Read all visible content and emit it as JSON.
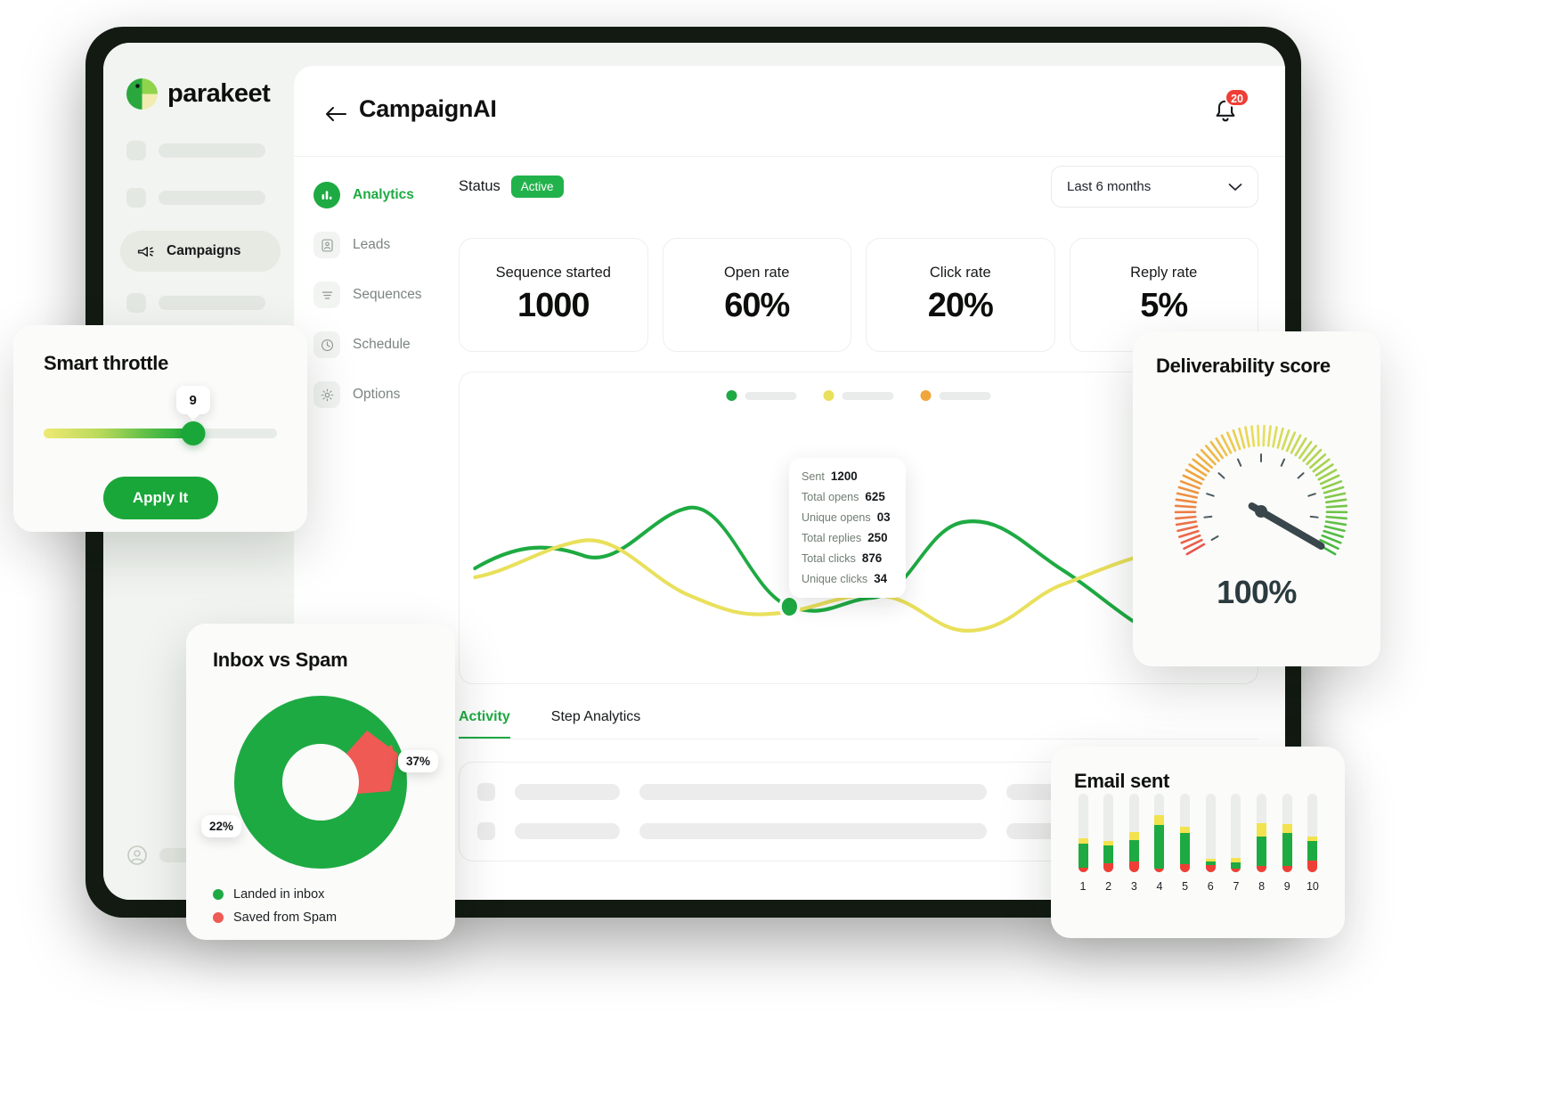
{
  "brand": {
    "name": "parakeet",
    "logo_icon": "parakeet-logo-icon"
  },
  "sidebar": {
    "active_item": {
      "label": "Campaigns",
      "icon": "megaphone-icon"
    },
    "placeholder_rows": 5
  },
  "topbar": {
    "back_icon": "arrow-left-icon",
    "title": "CampaignAI",
    "bell_icon": "bell-icon",
    "notification_count": "20"
  },
  "subnav": {
    "items": [
      {
        "label": "Analytics",
        "icon": "bar-chart-icon",
        "active": true
      },
      {
        "label": "Leads",
        "icon": "contact-card-icon",
        "active": false
      },
      {
        "label": "Sequences",
        "icon": "list-lines-icon",
        "active": false
      },
      {
        "label": "Schedule",
        "icon": "clock-icon",
        "active": false
      },
      {
        "label": "Options",
        "icon": "gear-icon",
        "active": false
      }
    ]
  },
  "status": {
    "label": "Status",
    "value": "Active"
  },
  "range_select": {
    "value": "Last 6 months",
    "icon": "chevron-down-icon"
  },
  "kpis": [
    {
      "title": "Sequence started",
      "value": "1000"
    },
    {
      "title": "Open rate",
      "value": "60%"
    },
    {
      "title": "Click rate",
      "value": "20%"
    },
    {
      "title": "Reply rate",
      "value": "5%"
    }
  ],
  "chart_data": {
    "type": "line",
    "title": "",
    "xlabel": "",
    "ylabel": "",
    "legend_position": "top-center",
    "grid": false,
    "series": [
      {
        "name": "series-green",
        "color": "#1eaa42",
        "values": [
          32,
          30,
          26,
          22,
          30,
          58,
          72,
          55,
          35,
          40,
          62,
          72,
          58,
          34,
          18
        ]
      },
      {
        "name": "series-yellow",
        "color": "#e9e05c",
        "values": [
          52,
          58,
          62,
          54,
          42,
          36,
          30,
          36,
          40,
          34,
          30,
          38,
          52,
          62,
          66
        ]
      },
      {
        "name": "series-orange",
        "color": "#f0a63c",
        "values": []
      }
    ],
    "legend": [
      {
        "color": "#1eaa42"
      },
      {
        "color": "#e9e05c"
      },
      {
        "color": "#f0a63c"
      }
    ],
    "tooltip": {
      "rows": [
        {
          "key": "Sent",
          "value": "1200"
        },
        {
          "key": "Total opens",
          "value": "625"
        },
        {
          "key": "Unique opens",
          "value": "03"
        },
        {
          "key": "Total replies",
          "value": "250"
        },
        {
          "key": "Total clicks",
          "value": "876"
        },
        {
          "key": "Unique clicks",
          "value": "34"
        }
      ]
    }
  },
  "tabs": [
    {
      "label": "Activity",
      "active": true
    },
    {
      "label": "Step Analytics",
      "active": false
    }
  ],
  "smart_throttle": {
    "title": "Smart throttle",
    "slider_value": "9",
    "button_label": "Apply It"
  },
  "inbox_vs_spam": {
    "title": "Inbox vs Spam",
    "chart_data": {
      "type": "pie",
      "title": "Inbox vs Spam",
      "labels": [
        "Landed in inbox",
        "Saved from Spam"
      ],
      "values": [
        22,
        37
      ],
      "display_labels": [
        "22%",
        "37%"
      ],
      "colors": [
        "#1eaa42",
        "#ef5a54"
      ]
    },
    "legend": [
      {
        "label": "Landed in inbox",
        "color": "#1eaa42"
      },
      {
        "label": "Saved from Spam",
        "color": "#ef5a54"
      }
    ]
  },
  "deliverability": {
    "title": "Deliverability score",
    "value": "100%",
    "chart_data": {
      "type": "gauge",
      "title": "Deliverability score",
      "value": 100,
      "range": [
        0,
        100
      ],
      "needle_angle_deg": 48,
      "colors": [
        "#e8564c",
        "#f0a63c",
        "#e9e05c",
        "#9ed150",
        "#3fb73f"
      ]
    }
  },
  "email_sent": {
    "title": "Email sent",
    "chart_data": {
      "type": "bar",
      "title": "Email sent",
      "categories": [
        "1",
        "2",
        "3",
        "4",
        "5",
        "6",
        "7",
        "8",
        "9",
        "10"
      ],
      "series": [
        {
          "name": "green",
          "color": "#1eaa42",
          "values": [
            24,
            18,
            22,
            44,
            32,
            4,
            6,
            30,
            34,
            20
          ]
        },
        {
          "name": "yellow",
          "color": "#f2e34e",
          "values": [
            6,
            5,
            8,
            10,
            6,
            3,
            5,
            14,
            9,
            4
          ]
        },
        {
          "name": "red",
          "color": "#ee3f36",
          "values": [
            5,
            9,
            11,
            4,
            8,
            7,
            4,
            6,
            6,
            12
          ]
        },
        {
          "name": "track",
          "color": "#ebedea",
          "values": [
            80,
            80,
            80,
            80,
            80,
            80,
            80,
            80,
            80,
            80
          ]
        }
      ],
      "ylim": [
        0,
        80
      ]
    }
  }
}
